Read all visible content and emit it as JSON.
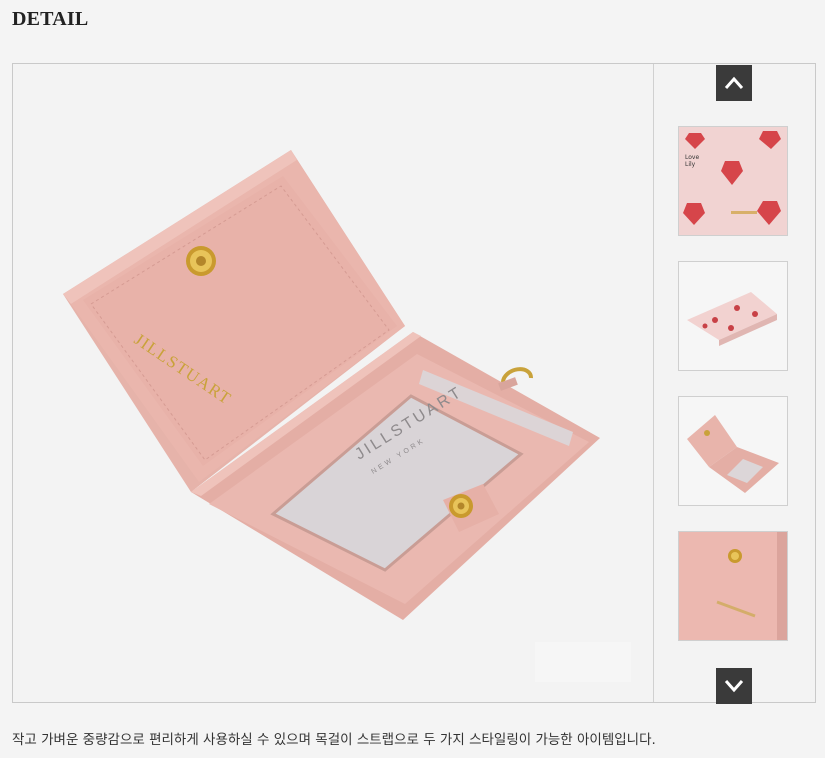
{
  "section": {
    "title": "DETAIL"
  },
  "viewer": {
    "product_brand_inner": "JILLSTUART",
    "product_brand_sub": "NEW YORK",
    "product_brand_flap": "JILLSTUART",
    "thumbs": [
      {
        "name": "pink-heart-pattern-front",
        "icon": "card-wallet-heart-print"
      },
      {
        "name": "pink-heart-pattern-side",
        "icon": "card-wallet-heart-print-side"
      },
      {
        "name": "pink-open-wallet",
        "icon": "card-wallet-open"
      },
      {
        "name": "pink-closeup",
        "icon": "card-wallet-closeup"
      }
    ],
    "nav": {
      "up_icon": "chevron-up-icon",
      "down_icon": "chevron-down-icon"
    }
  },
  "description": "작고 가벼운 중량감으로 편리하게 사용하실 수 있으며 목걸이 스트랩으로 두 가지 스타일링이 가능한 아이템입니다.",
  "colors": {
    "pink": "#e9b6ae",
    "pink_dark": "#d89a92",
    "gold": "#c9a23a",
    "window": "#d7d3d6",
    "nav_bg": "#3a3a3a"
  }
}
